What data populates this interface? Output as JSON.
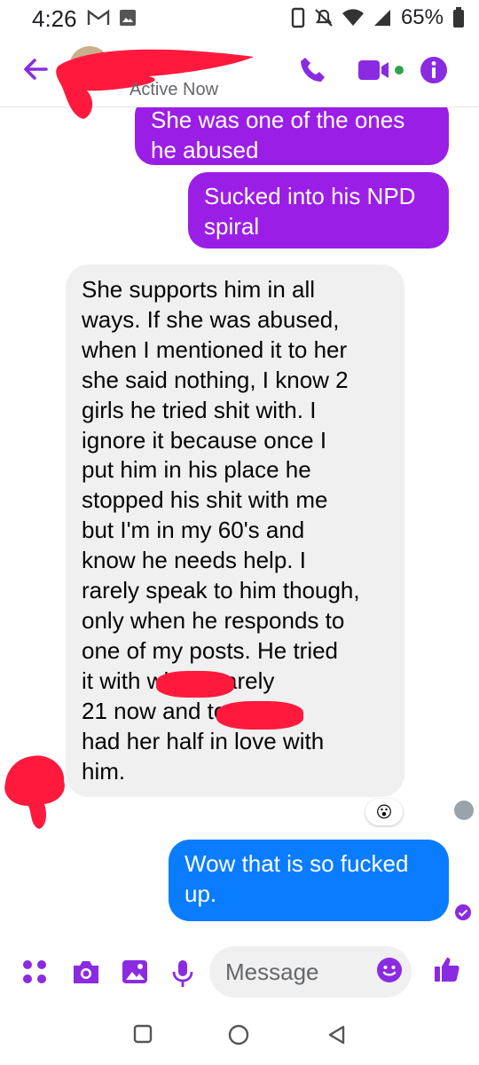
{
  "status_bar": {
    "time": "4:26",
    "battery": "65%"
  },
  "header": {
    "status": "Active Now",
    "icons": [
      "back-arrow-icon",
      "phone-icon",
      "video-camera-icon",
      "info-icon"
    ]
  },
  "messages": [
    {
      "direction": "outgoing",
      "text": "She was one of the ones\nhe abused",
      "color": "#9b1ee6"
    },
    {
      "direction": "outgoing",
      "text": "Sucked into his NPD\nspiral",
      "color": "#9b1ee6"
    },
    {
      "direction": "incoming",
      "text": "She supports him in all\nways. If she was abused,\nwhen I mentioned it to her\nshe said nothing, I know 2\ngirls he tried shit with. I\nignore it because once I\nput him in his place he\nstopped his shit with me\nbut I'm in my 60's and\nknow he needs help. I\nrarely speak to him though,\nonly when he responds to\none of my posts.  He tried\nit with              who's barely\n21 now and              too,\nhad her half in love with\nhim.",
      "reaction": "😮"
    },
    {
      "direction": "outgoing",
      "text": "Wow that is so fucked\nup.",
      "color": "#0a7cff"
    }
  ],
  "composer": {
    "placeholder": "Message",
    "icons": [
      "apps-icon",
      "camera-icon",
      "image-icon",
      "microphone-icon",
      "emoji-icon",
      "thumbs-up-icon"
    ]
  },
  "navbar": {
    "icons": [
      "recents-square-icon",
      "home-circle-icon",
      "back-triangle-icon"
    ]
  },
  "colors": {
    "accent": "#8a2be2",
    "outgoing_purple": "#9b1ee6",
    "outgoing_blue": "#0a7cff",
    "incoming_bg": "#f0f0f0",
    "redaction": "#ff1a3d"
  }
}
